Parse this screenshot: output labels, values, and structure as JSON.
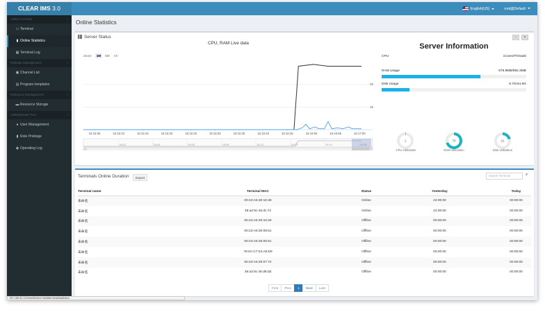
{
  "app": {
    "name": "CLEAR IMS",
    "version": "3.0"
  },
  "header": {
    "language": "English(US)",
    "user": "root@Default"
  },
  "sidebar": {
    "sections": [
      {
        "title": "Admin Console",
        "items": [
          {
            "label": "Terminal",
            "icon": "monitor-icon"
          },
          {
            "label": "Online Statistics",
            "icon": "bar-chart-icon",
            "active": true
          },
          {
            "label": "Terminal Log",
            "icon": "calendar-icon"
          }
        ]
      },
      {
        "title": "Release Management",
        "items": [
          {
            "label": "Channel List",
            "icon": "channel-icon"
          },
          {
            "label": "Program templates",
            "icon": "template-icon"
          }
        ]
      },
      {
        "title": "Resource Management",
        "items": [
          {
            "label": "Resource Storage",
            "icon": "folder-icon"
          }
        ]
      },
      {
        "title": "Administrator Tool",
        "items": [
          {
            "label": "User Management",
            "icon": "user-icon"
          },
          {
            "label": "Role Privilege",
            "icon": "book-icon"
          },
          {
            "label": "Operating Log",
            "icon": "eye-icon"
          }
        ]
      }
    ]
  },
  "page": {
    "title": "Online Statistics"
  },
  "server_status": {
    "title": "Server Status",
    "minimize": "−",
    "close": "×",
    "chart_title": "CPU, RAM Live data",
    "zoom_label": "Zoom",
    "zoom_options": [
      "1M",
      "5M",
      "All"
    ],
    "zoom_selected": "1M"
  },
  "server_info": {
    "title": "Server Information",
    "cpu_label": "CPU",
    "cpu_value": "1Core2Threads",
    "ram_label": "RAM Usage",
    "ram_value": "679.9MB/992.3MB",
    "ram_fraction": 0.685,
    "disk_label": "Disk Usage",
    "disk_value": "8.7G/44.9G",
    "disk_fraction": 0.194,
    "gauges": [
      {
        "label": "CPU Utilization",
        "value": "1",
        "fraction": 0.01
      },
      {
        "label": "RAM Utilization",
        "value": "70",
        "fraction": 0.7
      },
      {
        "label": "Disk Utilization",
        "value": "21",
        "fraction": 0.21
      }
    ]
  },
  "chart_data": {
    "type": "line",
    "title": "CPU, RAM Live data",
    "x_ticks": [
      "16:16:05",
      "16:16:10",
      "16:16:15",
      "16:16:20",
      "16:16:25",
      "16:16:30",
      "16:16:35",
      "16:16:40",
      "16:16:45",
      "16:16:50",
      "16:16:55",
      "16:17:00"
    ],
    "y_ticks": [
      25,
      50
    ],
    "ylim": [
      0,
      75
    ],
    "navigator_ticks": [
      "16:02",
      "16:04",
      "16:06",
      "16:08",
      "16:10",
      "16:12",
      "16:14",
      "16:16"
    ],
    "series": [
      {
        "color": "#333333",
        "points": [
          [
            0,
            0
          ],
          [
            10,
            0
          ],
          [
            20,
            0
          ],
          [
            30,
            0
          ],
          [
            40,
            0
          ],
          [
            50,
            0
          ],
          [
            56,
            0
          ],
          [
            56.8,
            0
          ],
          [
            58,
            70
          ],
          [
            62,
            72
          ],
          [
            66,
            70
          ],
          [
            70,
            70
          ],
          [
            75,
            70
          ]
        ]
      },
      {
        "color": "#4aa3df",
        "points": [
          [
            0,
            0
          ],
          [
            56,
            0
          ],
          [
            57.5,
            0
          ],
          [
            59,
            2
          ],
          [
            60,
            6
          ],
          [
            61,
            1
          ],
          [
            62.5,
            3
          ],
          [
            63.5,
            1
          ],
          [
            65,
            1
          ],
          [
            66,
            9
          ],
          [
            67,
            1
          ],
          [
            68.5,
            2
          ],
          [
            70,
            1
          ],
          [
            71.5,
            3
          ],
          [
            72.5,
            1
          ],
          [
            75,
            1
          ]
        ]
      }
    ]
  },
  "terminals": {
    "title": "Terminals Online Duration",
    "export_label": "Export",
    "search_placeholder": "Search Terminal",
    "columns": [
      "Terminal name",
      "Terminal MAC",
      "Status",
      "Yesterday",
      "Today"
    ],
    "rows": [
      [
        "未命名",
        "00:23:A5:30:10:48",
        "Online",
        "24:00:00",
        "00:00:00"
      ],
      [
        "未命名",
        "38:a2:8c:45:dc:72",
        "Online",
        "24:00:00",
        "00:00:00"
      ],
      [
        "未命名",
        "00:23:A5:30:10:29",
        "Offline",
        "00:00:00",
        "00:00:00"
      ],
      [
        "未命名",
        "00:23:A5:30:08:51",
        "Offline",
        "00:00:00",
        "00:00:00"
      ],
      [
        "未命名",
        "00:23:A5:30:00:51",
        "Offline",
        "00:00:00",
        "00:00:00"
      ],
      [
        "未命名",
        "78:0A:C7:04:A8:D9",
        "Offline",
        "00:00:00",
        "00:00:00"
      ],
      [
        "未命名",
        "00:23:A5:30:07:72",
        "Offline",
        "00:00:00",
        "00:00:00"
      ],
      [
        "未命名",
        "38:a2:8c:45:d8:dd",
        "Offline",
        "00:00:00",
        "00:00:00"
      ]
    ],
    "pagination": {
      "first": "First",
      "prev": "Prev",
      "current": "1",
      "next": "Next",
      "last": "Last"
    }
  },
  "status_bar": {
    "url": "192.168.30.110/ims3/index.html#terminal/statistics"
  }
}
